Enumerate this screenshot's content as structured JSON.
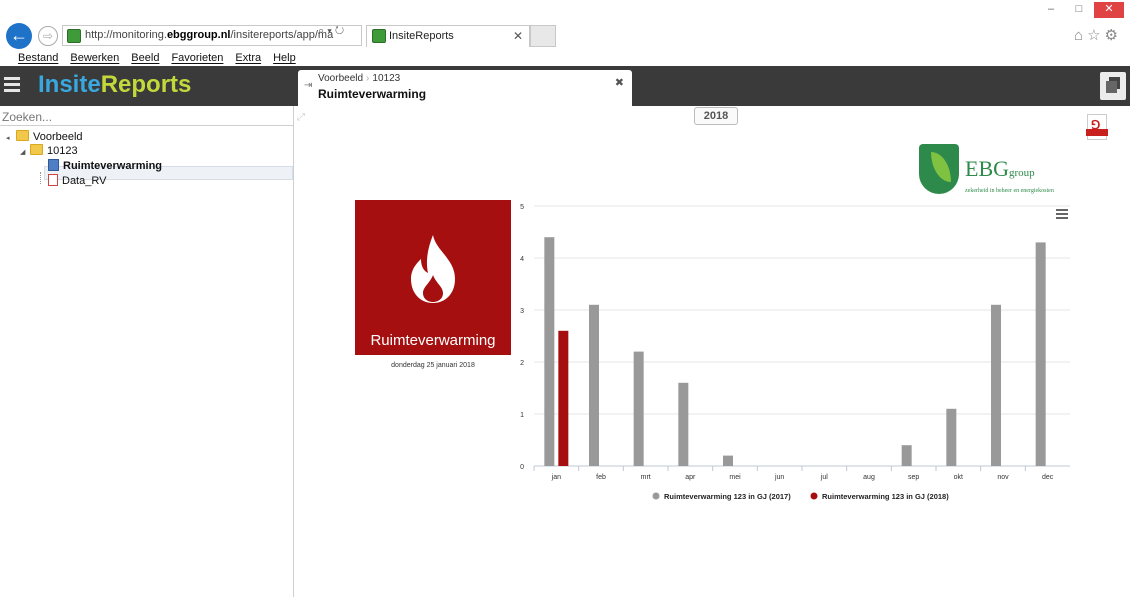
{
  "browser": {
    "url_prefix": "http://monitoring.",
    "url_domain": "ebggroup.nl",
    "url_suffix": "/insitereports/app/ma",
    "url_tools": "⌕ ▾ ↻",
    "tab_title": "InsiteReports",
    "tab_close": "✕",
    "window_min": "–",
    "window_max": "□",
    "window_close": "✕",
    "right_tools": "⌂☆⚙",
    "back": "←",
    "forward": "⇨"
  },
  "menu": [
    "Bestand",
    "Bewerken",
    "Beeld",
    "Favorieten",
    "Extra",
    "Help"
  ],
  "app": {
    "logo_part1": "Insite",
    "logo_part2": "Reports",
    "doc_crumb1": "Voorbeeld",
    "doc_crumb_sep": "›",
    "doc_crumb2": "10123",
    "doc_title": "Ruimteverwarming",
    "doc_close": "✖",
    "doc_pin": "⇥"
  },
  "sidebar": {
    "search_placeholder": "Zoeken...",
    "tree": {
      "root": "Voorbeeld",
      "child": "10123",
      "item1": "Ruimteverwarming",
      "item2": "Data_RV"
    }
  },
  "main": {
    "year": "2018",
    "expand_icon": "⤢",
    "pdf_icon": "⅁",
    "logo_name": "EBG",
    "logo_name_small": "group",
    "logo_tagline": "zekerheid in beheer en energiekosten",
    "tile_label": "Ruimteverwarming",
    "tile_date": "donderdag 25 januari 2018"
  },
  "chart_data": {
    "type": "bar",
    "categories": [
      "jan",
      "feb",
      "mrt",
      "apr",
      "mei",
      "jun",
      "jul",
      "aug",
      "sep",
      "okt",
      "nov",
      "dec"
    ],
    "series": [
      {
        "name": "Ruimteverwarming 123 in GJ (2017)",
        "color": "#999999",
        "values": [
          4.4,
          3.1,
          2.2,
          1.6,
          0.2,
          0,
          0,
          0,
          0.4,
          1.1,
          3.1,
          4.3
        ]
      },
      {
        "name": "Ruimteverwarming 123 in GJ (2018)",
        "color": "#a50f0f",
        "values": [
          2.6,
          null,
          null,
          null,
          null,
          null,
          null,
          null,
          null,
          null,
          null,
          null
        ]
      }
    ],
    "yticks": [
      "0",
      "1",
      "2",
      "3",
      "4",
      "5"
    ],
    "ylim": [
      0,
      5
    ],
    "grid": true,
    "legend_position": "bottom"
  }
}
